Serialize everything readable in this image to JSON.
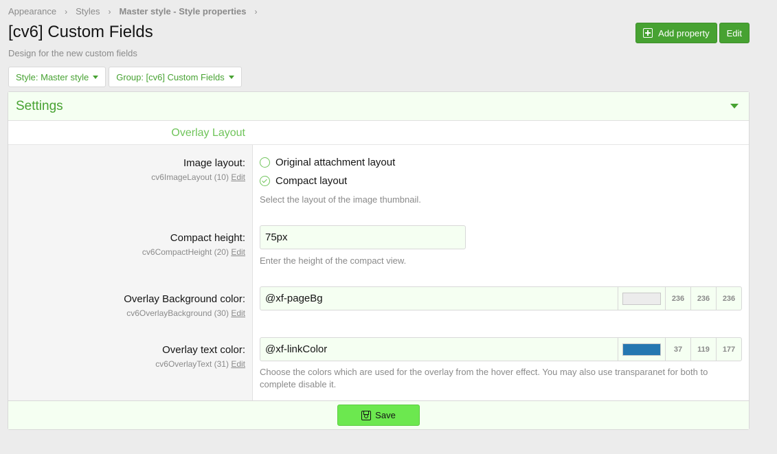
{
  "breadcrumb": {
    "items": [
      "Appearance",
      "Styles",
      "Master style - Style properties"
    ],
    "sep": "›"
  },
  "page": {
    "title": "[cv6] Custom Fields",
    "description": "Design for the new custom fields"
  },
  "toolbar": {
    "add_property_label": "Add property",
    "edit_label": "Edit"
  },
  "filters": {
    "style_label": "Style: Master style",
    "group_label": "Group: [cv6] Custom Fields"
  },
  "block": {
    "header_title": "Settings",
    "section_title": "Overlay Layout",
    "edit_link_label": "Edit",
    "fields": {
      "image_layout": {
        "label": "Image layout:",
        "meta": "cv6ImageLayout (10)",
        "options": [
          "Original attachment layout",
          "Compact layout"
        ],
        "selected": "Compact layout",
        "hint": "Select the layout of the image thumbnail."
      },
      "compact_height": {
        "label": "Compact height:",
        "meta": "cv6CompactHeight (20)",
        "value": "75px",
        "hint": "Enter the height of the compact view."
      },
      "overlay_bg": {
        "label": "Overlay Background color:",
        "meta": "cv6OverlayBackground (30)",
        "value": "@xf-pageBg",
        "swatch": "#ececec",
        "r": "236",
        "g": "236",
        "b": "236"
      },
      "overlay_text": {
        "label": "Overlay text color:",
        "meta": "cv6OverlayText (31)",
        "value": "@xf-linkColor",
        "swatch": "#2577b1",
        "r": "37",
        "g": "119",
        "b": "177",
        "hint_line1": "Choose the colors which are used for the overlay from the hover effect. You may also use transparanet for both to",
        "hint_line2": "complete disable it."
      }
    },
    "save_label": "Save"
  },
  "colors": {
    "accent": "#47a232",
    "save_bg": "#6ce84f"
  }
}
